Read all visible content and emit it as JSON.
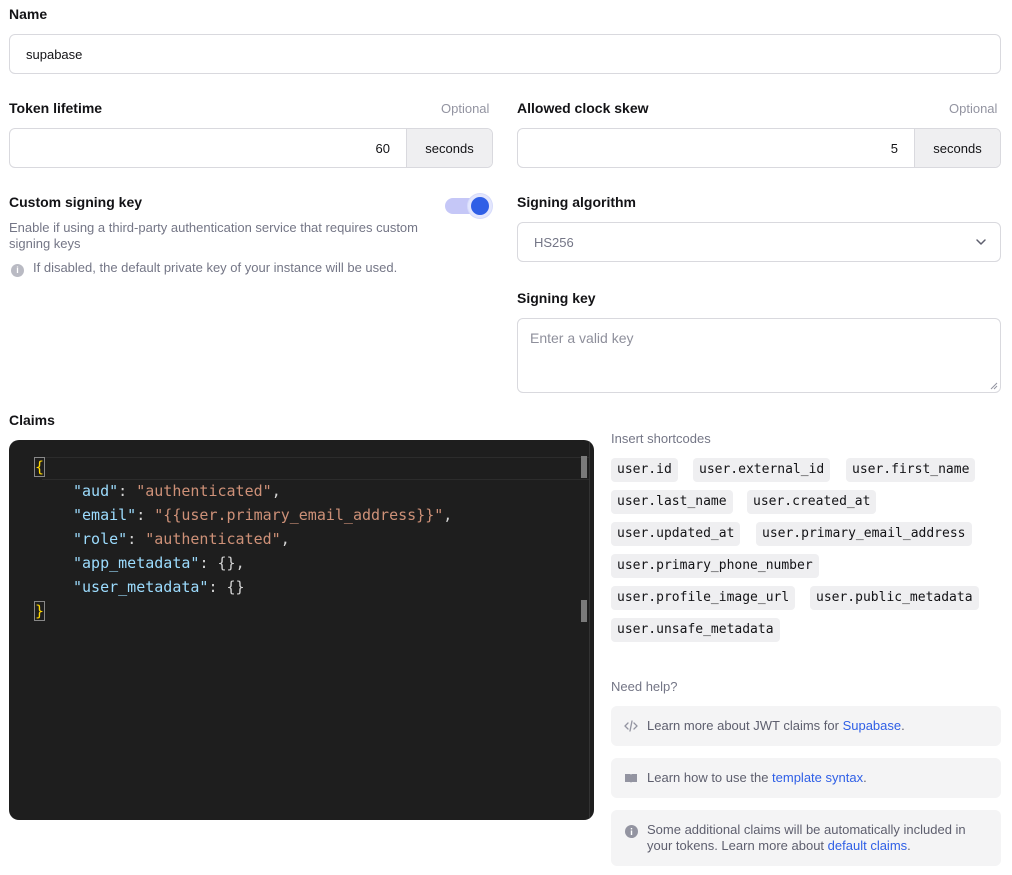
{
  "name": {
    "label": "Name",
    "value": "supabase"
  },
  "token_lifetime": {
    "label": "Token lifetime",
    "optional": "Optional",
    "value": "60",
    "unit": "seconds"
  },
  "clock_skew": {
    "label": "Allowed clock skew",
    "optional": "Optional",
    "value": "5",
    "unit": "seconds"
  },
  "custom_signing": {
    "label": "Custom signing key",
    "description": "Enable if using a third-party authentication service that requires custom signing keys",
    "note": "If disabled, the default private key of your instance will be used.",
    "enabled": true
  },
  "signing_algorithm": {
    "label": "Signing algorithm",
    "value": "HS256"
  },
  "signing_key": {
    "label": "Signing key",
    "placeholder": "Enter a valid key"
  },
  "claims": {
    "label": "Claims",
    "code": {
      "open": "{",
      "close": "}",
      "lines": [
        {
          "key": "\"aud\"",
          "sep": ": ",
          "value": "\"authenticated\"",
          "tail": ","
        },
        {
          "key": "\"email\"",
          "sep": ": ",
          "value": "\"{{user.primary_email_address}}\"",
          "tail": ","
        },
        {
          "key": "\"role\"",
          "sep": ": ",
          "value": "\"authenticated\"",
          "tail": ","
        },
        {
          "key": "\"app_metadata\"",
          "sep": ": ",
          "value": "{}",
          "tail": ","
        },
        {
          "key": "\"user_metadata\"",
          "sep": ": ",
          "value": "{}",
          "tail": ""
        }
      ]
    }
  },
  "shortcodes": {
    "title": "Insert shortcodes",
    "items": [
      "user.id",
      "user.external_id",
      "user.first_name",
      "user.last_name",
      "user.created_at",
      "user.updated_at",
      "user.primary_email_address",
      "user.primary_phone_number",
      "user.profile_image_url",
      "user.public_metadata",
      "user.unsafe_metadata"
    ]
  },
  "help": {
    "title": "Need help?",
    "items": [
      {
        "icon": "code-icon",
        "prefix": "Learn more about JWT claims for ",
        "link": "Supabase",
        "suffix": "."
      },
      {
        "icon": "book-icon",
        "prefix": "Learn how to use the ",
        "link": "template syntax",
        "suffix": "."
      },
      {
        "icon": "info-icon",
        "prefix": "Some additional claims will be automatically included in your tokens. Learn more about ",
        "link": "default claims",
        "suffix": "."
      }
    ]
  },
  "colors": {
    "accent": "#2f5fe6",
    "editor_bg": "#1e1e1e",
    "key": "#9cdcfe",
    "string": "#ce9178"
  }
}
